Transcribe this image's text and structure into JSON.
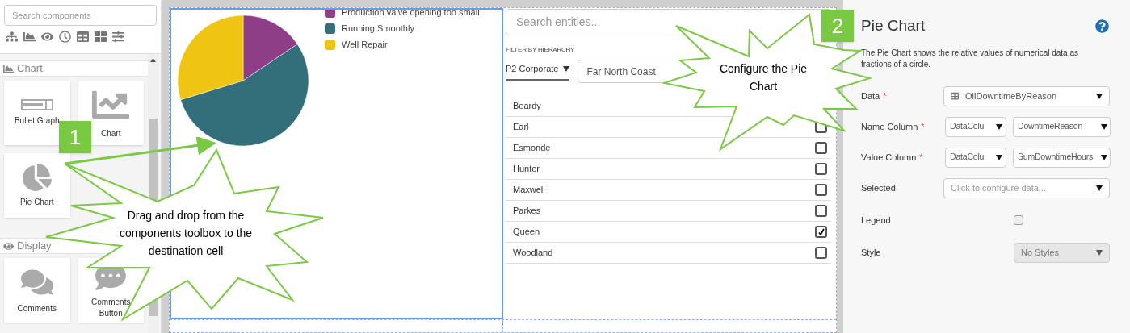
{
  "sidebar": {
    "search": {
      "placeholder": "Search components"
    },
    "sections": [
      {
        "title": "Chart",
        "items": [
          {
            "label": "Bullet Graph"
          },
          {
            "label": "Chart"
          },
          {
            "label": "Pie Chart"
          }
        ]
      },
      {
        "title": "Display",
        "items": [
          {
            "label": "Comments"
          },
          {
            "label": "Comments Button"
          }
        ]
      }
    ]
  },
  "pie_chart": {
    "legend": [
      {
        "label": "Production valve opening too small",
        "color": "#8e3e87"
      },
      {
        "label": "Running Smoothly",
        "color": "#336f7a"
      },
      {
        "label": "Well Repair",
        "color": "#f0c413"
      }
    ]
  },
  "entity_picker": {
    "search": {
      "placeholder": "Search entities..."
    },
    "filter_label": "FILTER BY HIERARCHY",
    "hierarchy": "P2 Corporate",
    "region": "Far North Coast",
    "entities": [
      {
        "name": "Beardy"
      },
      {
        "name": "Earl",
        "checked": false
      },
      {
        "name": "Esmonde",
        "checked": false
      },
      {
        "name": "Hunter",
        "checked": false
      },
      {
        "name": "Maxwell",
        "checked": false
      },
      {
        "name": "Parkes",
        "checked": false
      },
      {
        "name": "Queen",
        "checked": true
      },
      {
        "name": "Woodland",
        "checked": false
      }
    ]
  },
  "properties": {
    "title": "Pie Chart",
    "description": "The Pie Chart shows the relative values of numerical data as fractions of a circle.",
    "fields": [
      {
        "label": "Data",
        "marker": "*",
        "kind": "data-select",
        "value": "OilDowntimeByReason"
      },
      {
        "label": "Name Column",
        "marker": "*",
        "kind": "pair-select",
        "values": [
          "DataColu",
          "DowntimeReason"
        ]
      },
      {
        "label": "Value Column",
        "marker": "*",
        "kind": "pair-select",
        "values": [
          "DataColu",
          "SumDowntimeHours"
        ]
      },
      {
        "label": "Selected",
        "kind": "select",
        "placeholder": "Click to configure data..."
      },
      {
        "label": "Legend",
        "kind": "checkbox",
        "checked": false
      },
      {
        "label": "Style",
        "kind": "short-select",
        "value": "No Styles",
        "disabled": true
      }
    ]
  },
  "callouts": [
    {
      "number": "1",
      "text": "Drag and drop from the components toolbox to the destination cell"
    },
    {
      "number": "2",
      "text": "Configure the Pie Chart"
    }
  ]
}
